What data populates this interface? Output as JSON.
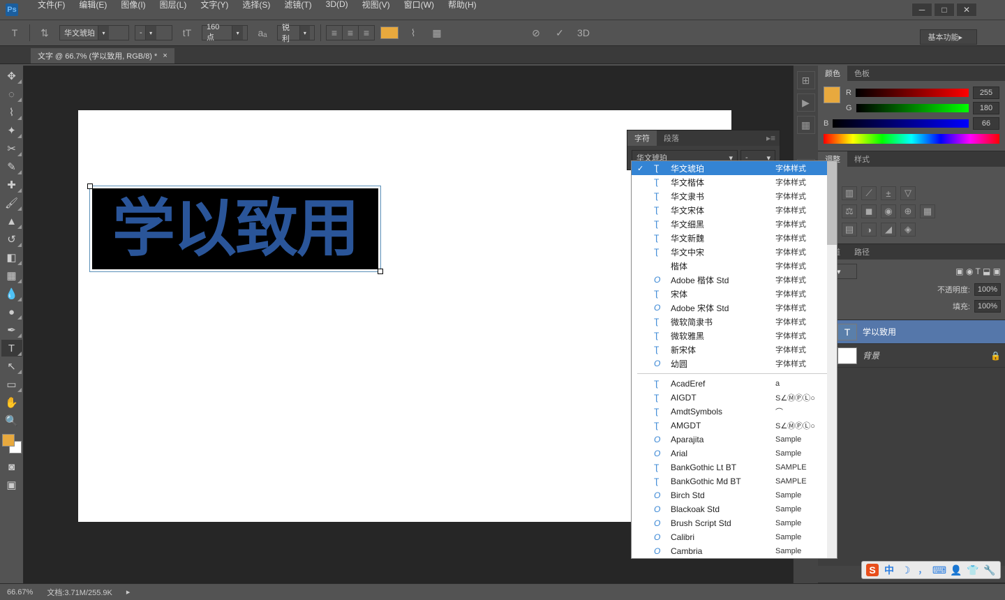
{
  "app": {
    "logo": "Ps"
  },
  "menu": [
    "文件(F)",
    "编辑(E)",
    "图像(I)",
    "图层(L)",
    "文字(Y)",
    "选择(S)",
    "滤镜(T)",
    "3D(D)",
    "视图(V)",
    "窗口(W)",
    "帮助(H)"
  ],
  "options": {
    "font": "华文琥珀",
    "style": "-",
    "size": "160 点",
    "aa": "锐利",
    "threeD": "3D"
  },
  "top_right_mode": "基本功能",
  "doc_tab": "文字 @ 66.7% (学以致用, RGB/8) *",
  "canvas_text": "学以致用",
  "char_panel": {
    "tab1": "字符",
    "tab2": "段落",
    "font": "华文琥珀",
    "style": "-"
  },
  "font_list": {
    "cn": [
      {
        "name": "华文琥珀",
        "sample": "字体样式",
        "sel": true,
        "ic": "T"
      },
      {
        "name": "华文楷体",
        "sample": "字体样式",
        "ic": "T"
      },
      {
        "name": "华文隶书",
        "sample": "字体样式",
        "ic": "T"
      },
      {
        "name": "华文宋体",
        "sample": "字体样式",
        "ic": "T"
      },
      {
        "name": "华文细黑",
        "sample": "字体样式",
        "ic": "T"
      },
      {
        "name": "华文新魏",
        "sample": "字体样式",
        "ic": "T"
      },
      {
        "name": "华文中宋",
        "sample": "字体样式",
        "ic": "T"
      },
      {
        "name": "楷体",
        "sample": "字体样式",
        "ic": ""
      },
      {
        "name": "Adobe 楷体 Std",
        "sample": "字体样式",
        "ic": "O"
      },
      {
        "name": "宋体",
        "sample": "字体样式",
        "ic": "T"
      },
      {
        "name": "Adobe 宋体 Std",
        "sample": "字体样式",
        "ic": "O"
      },
      {
        "name": "微软简隶书",
        "sample": "字体样式",
        "ic": "T"
      },
      {
        "name": "微软雅黑",
        "sample": "字体样式",
        "ic": "T"
      },
      {
        "name": "新宋体",
        "sample": "字体样式",
        "ic": "T"
      },
      {
        "name": "幼圆",
        "sample": "字体样式",
        "ic": "O"
      }
    ],
    "en": [
      {
        "name": "AcadEref",
        "sample": "a",
        "ic": "T"
      },
      {
        "name": "AIGDT",
        "sample": "S∠ⓂⓅⓁ○",
        "ic": "T"
      },
      {
        "name": "AmdtSymbols",
        "sample": "⌒",
        "ic": "T"
      },
      {
        "name": "AMGDT",
        "sample": "S∠ⓂⓅⓁ○",
        "ic": "T"
      },
      {
        "name": "Aparajita",
        "sample": "Sample",
        "ic": "O"
      },
      {
        "name": "Arial",
        "sample": "Sample",
        "ic": "O"
      },
      {
        "name": "BankGothic Lt BT",
        "sample": "SAMPLE",
        "ic": "T"
      },
      {
        "name": "BankGothic Md BT",
        "sample": "SAMPLE",
        "ic": "T"
      },
      {
        "name": "Birch Std",
        "sample": "Sample",
        "ic": "O"
      },
      {
        "name": "Blackoak Std",
        "sample": "Sample",
        "ic": "O"
      },
      {
        "name": "Brush Script Std",
        "sample": "Sample",
        "ic": "O"
      },
      {
        "name": "Calibri",
        "sample": "Sample",
        "ic": "O"
      },
      {
        "name": "Cambria",
        "sample": "Sample",
        "ic": "O"
      }
    ]
  },
  "color": {
    "tab1": "颜色",
    "tab2": "色板",
    "r": "R",
    "g": "G",
    "b": "B",
    "rv": "255",
    "gv": "180",
    "bv": "66"
  },
  "adjust": {
    "tab1": "调整",
    "tab2": "样式",
    "label": "调整"
  },
  "layers": {
    "tabs": [
      "通道",
      "路径"
    ],
    "opacity_lbl": "不透明度:",
    "opacity": "100%",
    "fill_lbl": "填充:",
    "fill": "100%",
    "items": [
      {
        "name": "学以致用",
        "type": "T",
        "sel": true
      },
      {
        "name": "背景",
        "type": "bg",
        "locked": true
      }
    ]
  },
  "status": {
    "zoom": "66.67%",
    "doc": "文档:3.71M/255.9K"
  },
  "taskbar": {
    "ime": "中"
  }
}
